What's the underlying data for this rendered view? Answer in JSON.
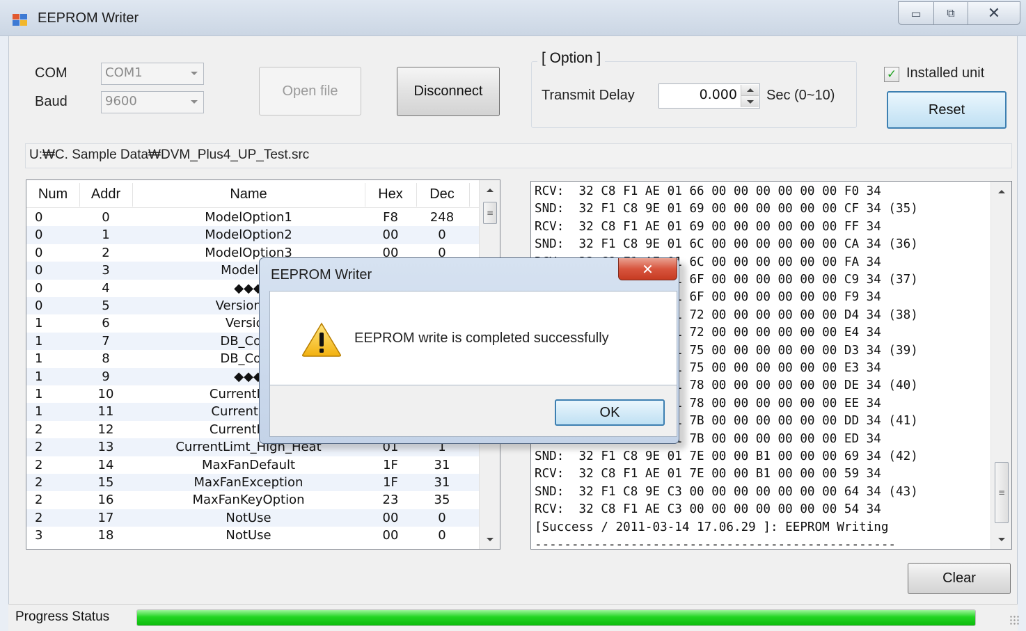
{
  "window": {
    "title": "EEPROM Writer",
    "controls": {
      "minimize": "▭",
      "maximize": "⧉",
      "close": "✕"
    }
  },
  "connection": {
    "com_label": "COM",
    "com_value": "COM1",
    "baud_label": "Baud",
    "baud_value": "9600"
  },
  "buttons": {
    "open_file": "Open file",
    "disconnect": "Disconnect",
    "reset": "Reset",
    "clear": "Clear"
  },
  "option": {
    "caption": "[ Option ]",
    "transmit_delay_label": "Transmit Delay",
    "transmit_delay_value": "0.000",
    "unit_label": "Sec (0~10)"
  },
  "installed_unit": {
    "label": "Installed unit",
    "checked": true
  },
  "file_path": "U:₩C. Sample Data₩DVM_Plus4_UP_Test.src",
  "grid": {
    "headers": [
      "Num",
      "Addr",
      "Name",
      "Hex",
      "Dec"
    ],
    "rows": [
      [
        "0",
        "0",
        "ModelOption1",
        "F8",
        "248"
      ],
      [
        "0",
        "1",
        "ModelOption2",
        "00",
        "0"
      ],
      [
        "0",
        "2",
        "ModelOption3",
        "00",
        "0"
      ],
      [
        "0",
        "3",
        "ModelOp",
        "",
        ""
      ],
      [
        "0",
        "4",
        "◆◆◆",
        "",
        ""
      ],
      [
        "0",
        "5",
        "Version_Ye",
        "",
        ""
      ],
      [
        "1",
        "6",
        "Version",
        "",
        ""
      ],
      [
        "1",
        "7",
        "DB_Code",
        "",
        ""
      ],
      [
        "1",
        "8",
        "DB_Code",
        "",
        ""
      ],
      [
        "1",
        "9",
        "◆◆◆",
        "",
        ""
      ],
      [
        "1",
        "10",
        "CurrentLimit",
        "",
        ""
      ],
      [
        "1",
        "11",
        "CurrentLimt",
        "",
        ""
      ],
      [
        "2",
        "12",
        "CurrentLimit",
        "",
        ""
      ],
      [
        "2",
        "13",
        "CurrentLimt_High_Heat",
        "01",
        "1"
      ],
      [
        "2",
        "14",
        "MaxFanDefault",
        "1F",
        "31"
      ],
      [
        "2",
        "15",
        "MaxFanException",
        "1F",
        "31"
      ],
      [
        "2",
        "16",
        "MaxFanKeyOption",
        "23",
        "35"
      ],
      [
        "2",
        "17",
        "NotUse",
        "00",
        "0"
      ],
      [
        "3",
        "18",
        "NotUse",
        "00",
        "0"
      ]
    ]
  },
  "log": {
    "lines": [
      "RCV:  32 C8 F1 AE 01 66 00 00 00 00 00 00 F0 34",
      "SND:  32 F1 C8 9E 01 69 00 00 00 00 00 00 CF 34 (35)",
      "RCV:  32 C8 F1 AE 01 69 00 00 00 00 00 00 FF 34",
      "SND:  32 F1 C8 9E 01 6C 00 00 00 00 00 00 CA 34 (36)",
      "RCV:  32 C8 F1 AE 01 6C 00 00 00 00 00 00 FA 34",
      "SND:  32 F1 C8 9E 01 6F 00 00 00 00 00 00 C9 34 (37)",
      "RCV:  32 C8 F1 AE 01 6F 00 00 00 00 00 00 F9 34",
      "SND:  32 F1 C8 9E 01 72 00 00 00 00 00 00 D4 34 (38)",
      "RCV:  32 C8 F1 AE 01 72 00 00 00 00 00 00 E4 34",
      "SND:  32 F1 C8 9E 01 75 00 00 00 00 00 00 D3 34 (39)",
      "RCV:  32 C8 F1 AE 01 75 00 00 00 00 00 00 E3 34",
      "SND:  32 F1 C8 9E 01 78 00 00 00 00 00 00 DE 34 (40)",
      "RCV:  32 C8 F1 AE 01 78 00 00 00 00 00 00 EE 34",
      "SND:  32 F1 C8 9E 01 7B 00 00 00 00 00 00 DD 34 (41)",
      "RCV:  32 C8 F1 AE 01 7B 00 00 00 00 00 00 ED 34",
      "SND:  32 F1 C8 9E 01 7E 00 00 B1 00 00 00 69 34 (42)",
      "RCV:  32 C8 F1 AE 01 7E 00 00 B1 00 00 00 59 34",
      "SND:  32 F1 C8 9E C3 00 00 00 00 00 00 00 64 34 (43)",
      "RCV:  32 C8 F1 AE C3 00 00 00 00 00 00 00 54 34",
      "[Success / 2011-03-14 17.06.29 ]: EEPROM Writing",
      "-------------------------------------------------"
    ]
  },
  "status": {
    "label": "Progress Status",
    "progress": 1.0,
    "color": "#22d522"
  },
  "dialog": {
    "title": "EEPROM Writer",
    "message": "EEPROM write is completed successfully",
    "ok_label": "OK",
    "icon": "warning-icon"
  }
}
